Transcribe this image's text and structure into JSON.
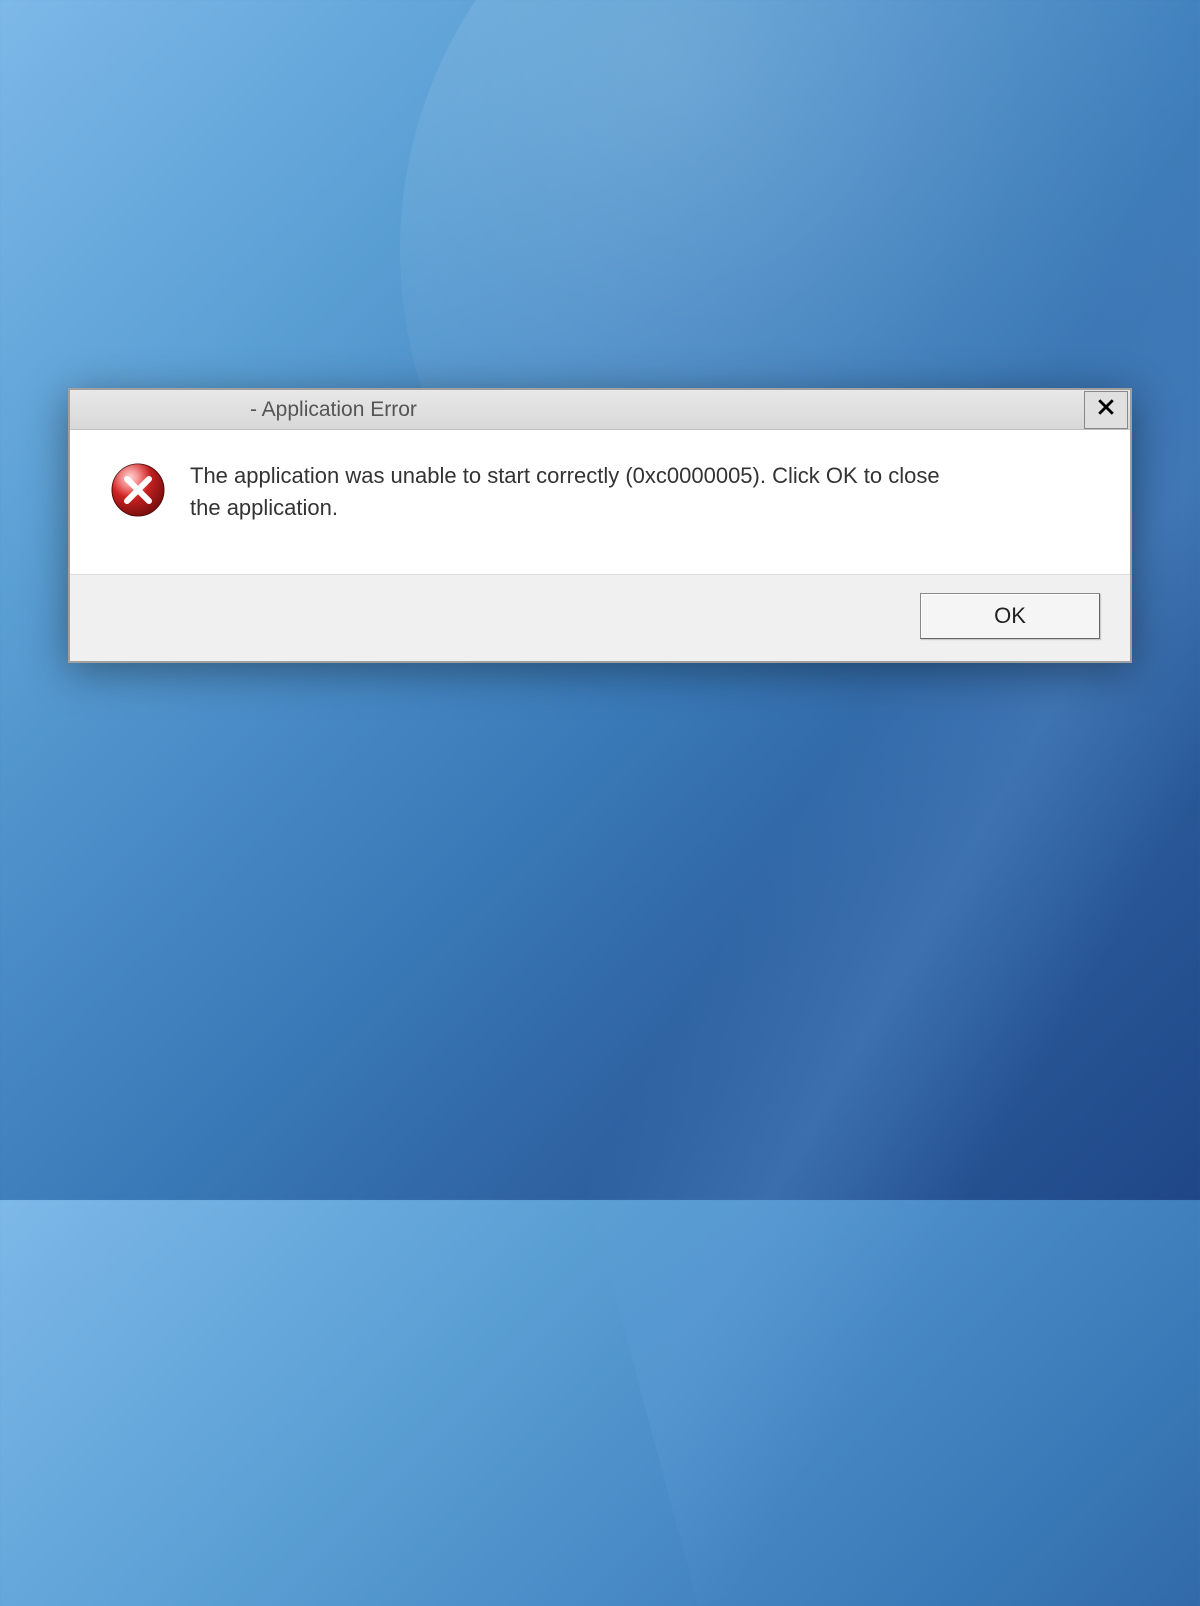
{
  "dialog": {
    "title": "- Application Error",
    "message": "The application was unable to start correctly (0xc0000005). Click OK to close the application.",
    "ok_label": "OK"
  }
}
